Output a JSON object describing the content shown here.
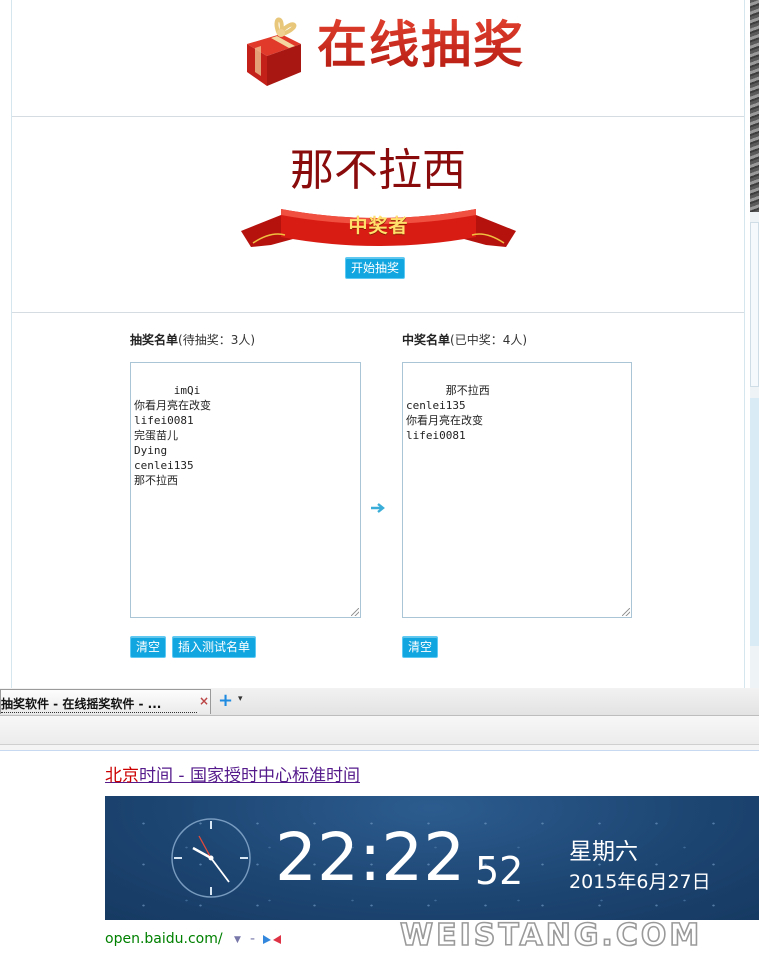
{
  "app": {
    "logo_text": "在线抽奖",
    "winner_name": "那不拉西",
    "winner_ribbon": "中奖者",
    "start_button": "开始抽奖"
  },
  "pending_list": {
    "title": "抽奖名单",
    "count_text": "(待抽奖：3人)",
    "entries": "imQi\n你看月亮在改变\nlifei0081\n完蛋苗儿\nDying\ncenlei135\n那不拉西",
    "clear_button": "清空",
    "insert_button": "插入测试名单"
  },
  "winner_list": {
    "title": "中奖名单",
    "count_text": "(已中奖：4人)",
    "entries": "那不拉西\ncenlei135\n你看月亮在改变\nlifei0081",
    "clear_button": "清空"
  },
  "browser": {
    "tab_title": "抽奖软件 - 在线摇奖软件 - ...",
    "tab_close": "×",
    "new_tab": "+",
    "tab_menu": "▾"
  },
  "search_result": {
    "title_part1": "北京",
    "title_part2": "时间",
    "title_part3": " - 国家授时中心标准时间",
    "time_main": "22:22",
    "time_seconds": "52",
    "weekday": "星期六",
    "date": "2015年6月27日",
    "url": "open.baidu.com/",
    "url_dash": "-"
  },
  "watermark": "WEISTANG.COM",
  "colors": {
    "accent_blue": "#12a6e0",
    "logo_red": "#c7281c",
    "winner_red": "#8a0b0b",
    "clock_bg": "#1d4673",
    "url_green": "#008000"
  },
  "icons": [
    "gift-box-icon",
    "ribbon-banner-icon",
    "right-arrow-icon",
    "analog-clock-icon",
    "tab-close-icon",
    "plus-icon",
    "baidu-share-icon"
  ]
}
